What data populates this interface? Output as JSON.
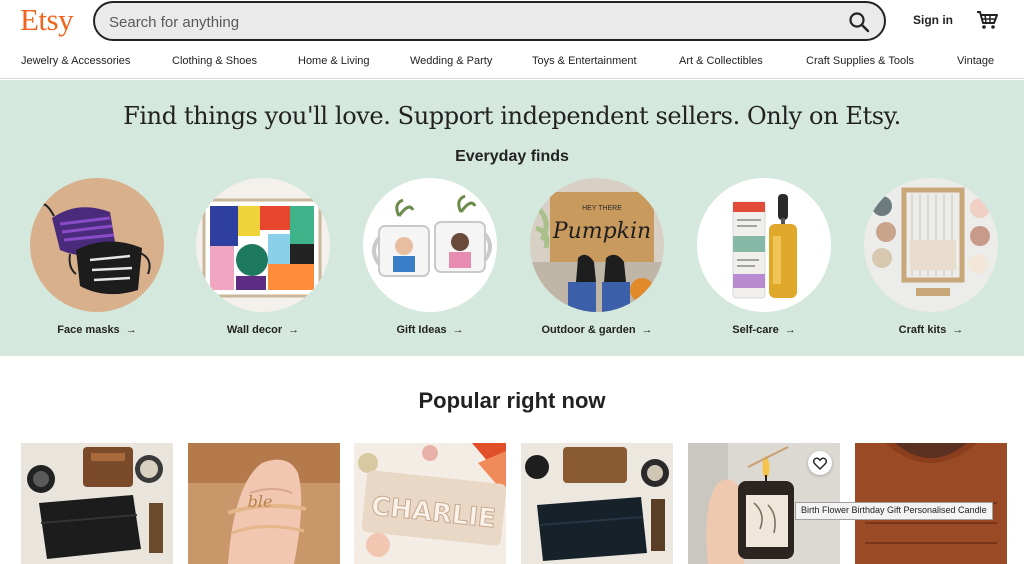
{
  "header": {
    "logo": "Etsy",
    "search_placeholder": "Search for anything",
    "signin": "Sign in"
  },
  "categories": [
    "Jewelry & Accessories",
    "Clothing & Shoes",
    "Home & Living",
    "Wedding & Party",
    "Toys & Entertainment",
    "Art & Collectibles",
    "Craft Supplies & Tools",
    "Vintage"
  ],
  "hero": {
    "title": "Find things you'll love. Support independent sellers. Only on Etsy.",
    "subtitle": "Everyday finds",
    "finds": [
      {
        "label": "Face masks"
      },
      {
        "label": "Wall decor"
      },
      {
        "label": "Gift Ideas"
      },
      {
        "label": "Outdoor & garden"
      },
      {
        "label": "Self-care"
      },
      {
        "label": "Craft kits"
      }
    ],
    "arrow": "→",
    "doormat_text": "Pumpkin",
    "doormat_small": "HEY THERE"
  },
  "popular": {
    "title": "Popular right now",
    "name_plate": "CHARLIE",
    "ring_text": "ble",
    "tooltip": "Birth Flower Birthday Gift Personalised Candle"
  },
  "colors": {
    "brand": "#F1641E",
    "hero_bg": "#D5E8DE"
  },
  "icons": {
    "search": "search-icon",
    "cart": "cart-icon",
    "favorite": "heart-icon",
    "arrow": "arrow-right-icon"
  }
}
